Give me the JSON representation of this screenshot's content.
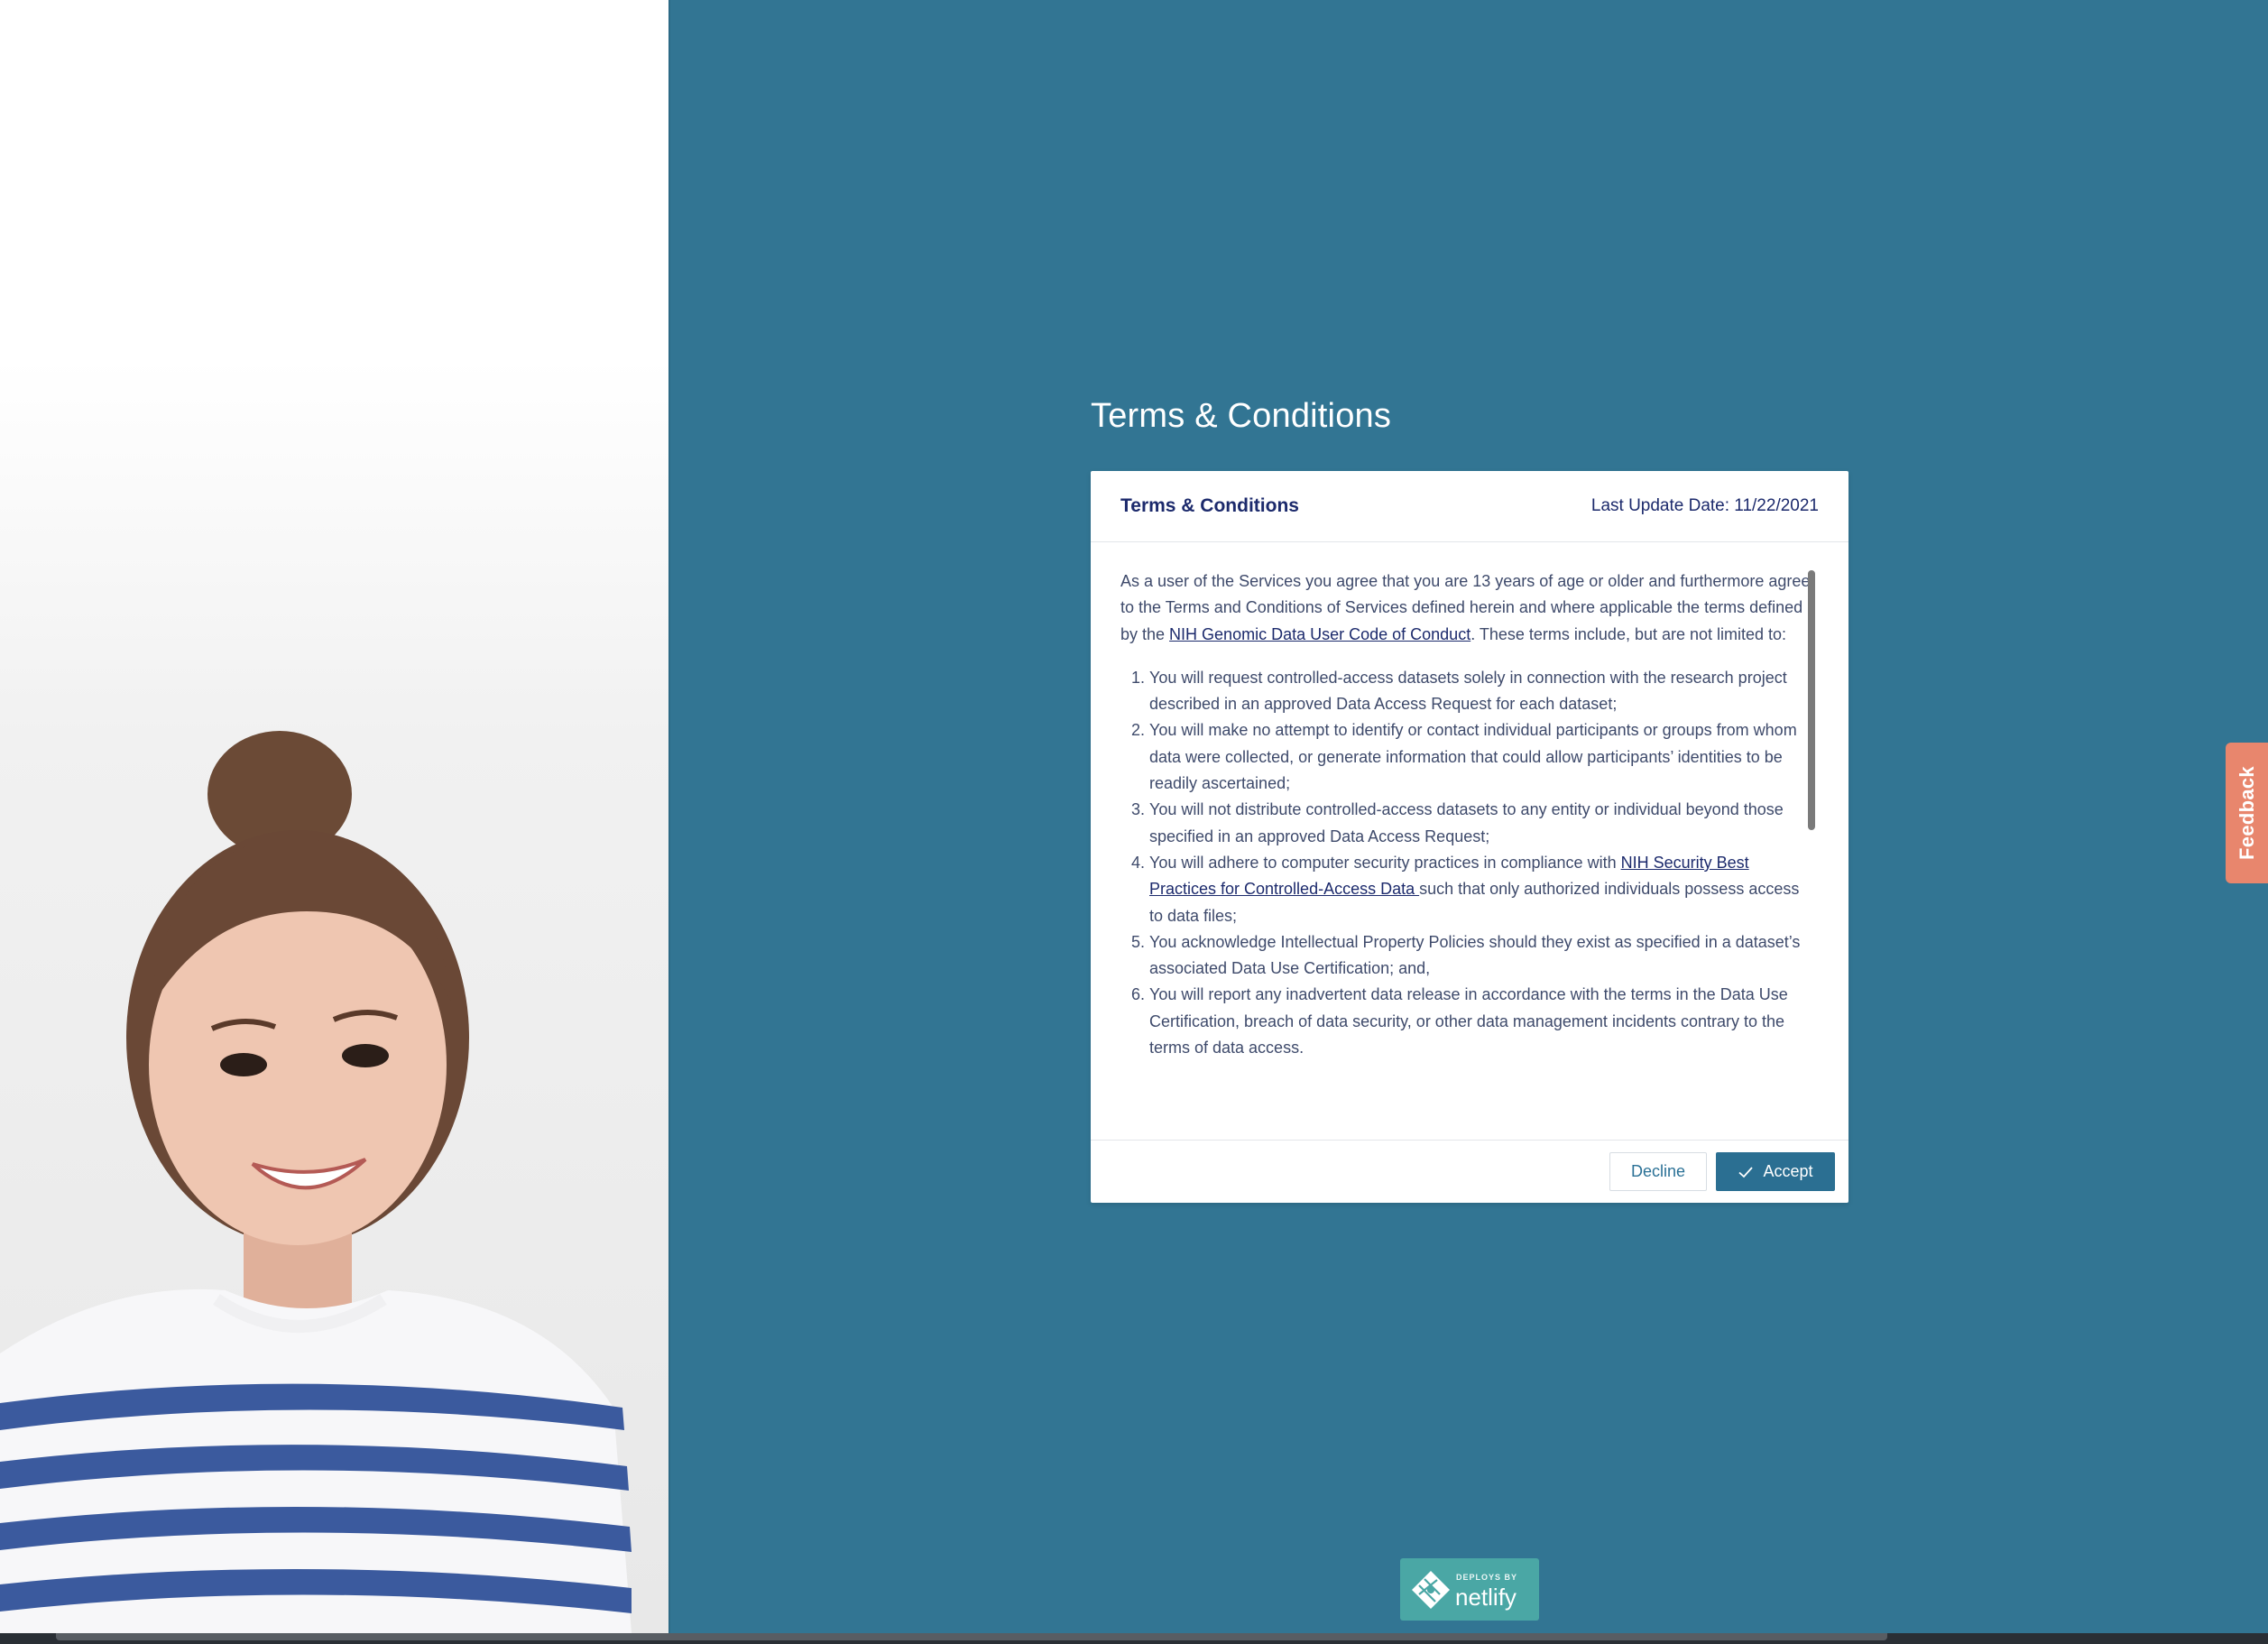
{
  "page": {
    "title": "Terms & Conditions"
  },
  "card": {
    "title": "Terms & Conditions",
    "last_update": "Last Update Date: 11/22/2021",
    "intro_before_link": "As a user of the Services you agree that you are 13 years of age or older and furthermore agree to the Terms and Conditions of Services defined herein and where applicable the terms defined by the ",
    "intro_link": "NIH Genomic Data User Code of Conduct",
    "intro_after_link": ". These terms include, but are not limited to:",
    "terms": [
      "You will request controlled-access datasets solely in connection with the research project described in an approved Data Access Request for each dataset;",
      "You will make no attempt to identify or contact individual participants or groups from whom data were collected, or generate information that could allow participants’ identities to be readily ascertained;",
      "You will not distribute controlled-access datasets to any entity or individual beyond those specified in an approved Data Access Request;",
      "You will adhere to computer security practices in compliance with ",
      "You acknowledge Intellectual Property Policies should they exist as specified in a dataset’s associated Data Use Certification; and,",
      "You will report any inadvertent data release in accordance with the terms in the Data Use Certification, breach of data security, or other data management incidents contrary to the terms of data access."
    ],
    "term4_link": "NIH Security Best Practices for Controlled-Access Data ",
    "term4_after": "such that only authorized individuals possess access to data files;",
    "decline_label": "Decline",
    "accept_label": "Accept"
  },
  "feedback_label": "Feedback",
  "netlify": {
    "small": "DEPLOYS BY",
    "big": "netlify"
  },
  "colors": {
    "background": "#327593",
    "accent_button": "#2b6f92",
    "feedback": "#e8866d",
    "netlify": "#4aa7a5"
  }
}
